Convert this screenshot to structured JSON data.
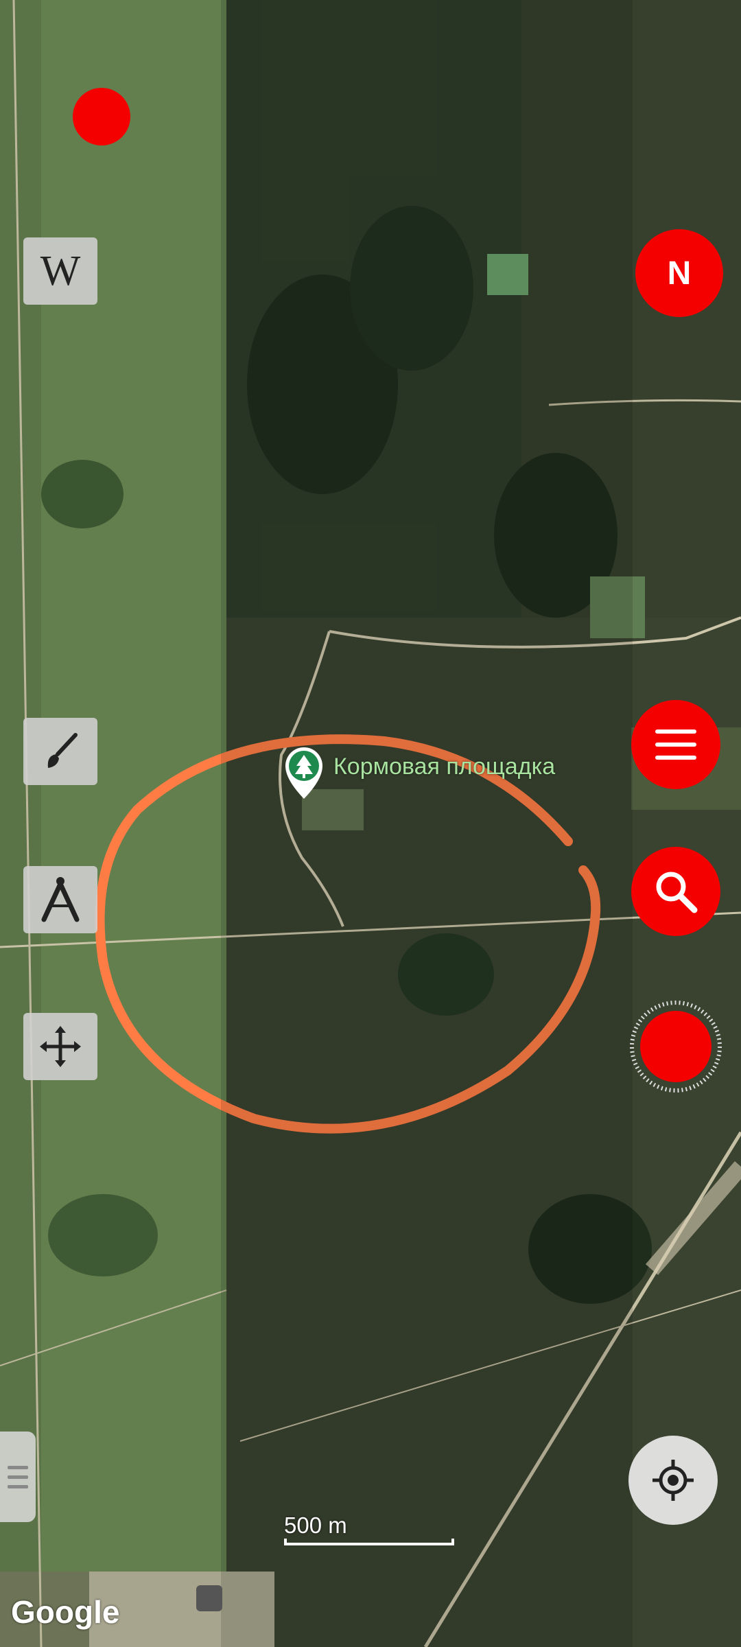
{
  "map": {
    "poi_label": "Кормовая площадка",
    "scale_label": "500 m",
    "attribution": "Google"
  },
  "controls": {
    "north_label": "N",
    "wikipedia_label": "W"
  },
  "icons": {
    "record": "record-dot-icon",
    "wikipedia": "wikipedia-icon",
    "compass": "compass-north-icon",
    "brush": "brush-icon",
    "divider": "measure-compass-icon",
    "move": "move-arrows-icon",
    "menu": "menu-icon",
    "search": "search-icon",
    "locate": "my-location-icon",
    "poi": "tree-poi-icon"
  },
  "colors": {
    "accent_red": "#f40000",
    "drawn_circle": "#ff7d45",
    "poi_text": "#a8e3a0"
  }
}
